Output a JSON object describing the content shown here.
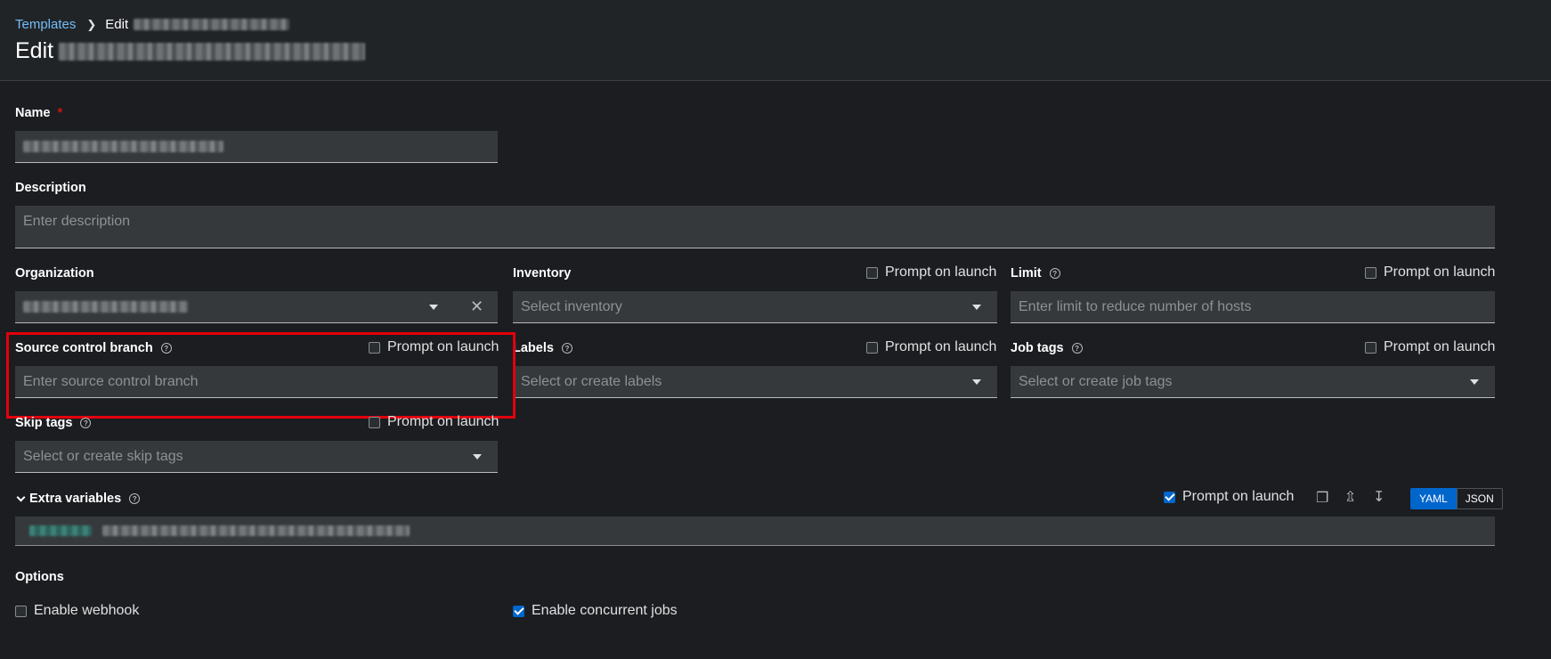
{
  "breadcrumb": {
    "root": "Templates",
    "current": "Edit"
  },
  "page": {
    "title": "Edit"
  },
  "form": {
    "name": {
      "label": "Name",
      "required_mark": "*"
    },
    "description": {
      "label": "Description",
      "placeholder": "Enter description"
    },
    "organization": {
      "label": "Organization"
    },
    "inventory": {
      "label": "Inventory",
      "placeholder": "Select inventory",
      "prompt": "Prompt on launch",
      "prompt_checked": false
    },
    "limit": {
      "label": "Limit",
      "placeholder": "Enter limit to reduce number of hosts",
      "prompt": "Prompt on launch",
      "prompt_checked": false
    },
    "scm_branch": {
      "label": "Source control branch",
      "placeholder": "Enter source control branch",
      "prompt": "Prompt on launch",
      "prompt_checked": false
    },
    "labels": {
      "label": "Labels",
      "placeholder": "Select or create labels",
      "prompt": "Prompt on launch",
      "prompt_checked": false
    },
    "job_tags": {
      "label": "Job tags",
      "placeholder": "Select or create job tags",
      "prompt": "Prompt on launch",
      "prompt_checked": false
    },
    "skip_tags": {
      "label": "Skip tags",
      "placeholder": "Select or create skip tags",
      "prompt": "Prompt on launch",
      "prompt_checked": false
    },
    "extra_vars": {
      "label": "Extra variables",
      "prompt": "Prompt on launch",
      "prompt_checked": true,
      "mode_yaml": "YAML",
      "mode_json": "JSON",
      "active_mode": "YAML"
    },
    "options": {
      "label": "Options",
      "webhook": {
        "label": "Enable webhook",
        "checked": false
      },
      "concurrent": {
        "label": "Enable concurrent jobs",
        "checked": true
      }
    }
  },
  "icons": {
    "breadcrumb_sep": "chevron-right-icon",
    "help": "question-circle-icon",
    "copy": "copy-icon",
    "upload": "upload-icon",
    "download": "download-icon",
    "expand": "chevron-down-icon"
  },
  "colors": {
    "accent": "#0066cc",
    "link": "#73bcf7",
    "required": "#c9190b",
    "highlight": "#e3000b"
  }
}
